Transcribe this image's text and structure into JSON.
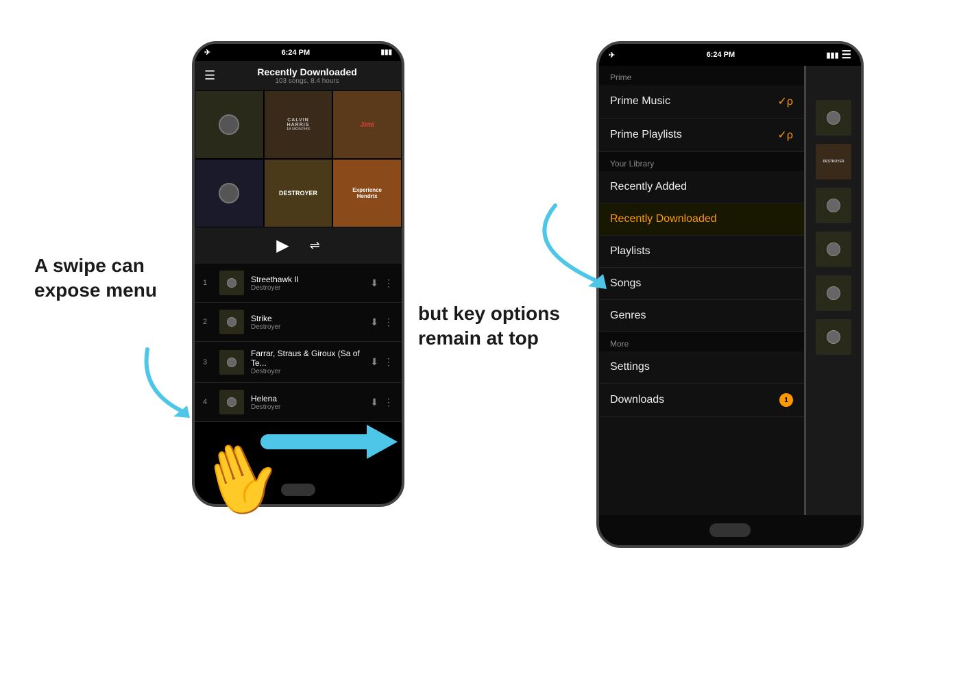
{
  "page": {
    "background": "#ffffff"
  },
  "annotation_left": {
    "line1": "A swipe can",
    "line2": "expose menu"
  },
  "annotation_right": {
    "line1": "but key options",
    "line2": "remain at top"
  },
  "phone_left": {
    "status_bar": {
      "signal": "✈",
      "time": "6:24 PM",
      "battery": "▮▮▮"
    },
    "header": {
      "title": "Recently Downloaded",
      "subtitle": "103 songs, 8.4 hours"
    },
    "songs": [
      {
        "num": "1",
        "title": "Streethawk II",
        "artist": "Destroyer"
      },
      {
        "num": "2",
        "title": "Strike",
        "artist": "Destroyer"
      },
      {
        "num": "3",
        "title": "Farrar, Straus & Giroux (S⁠a of Te...",
        "artist": "Destroyer"
      },
      {
        "num": "4",
        "title": "Helena",
        "artist": "Destroyer"
      }
    ]
  },
  "phone_right": {
    "status_bar": {
      "signal": "✈",
      "time": "6:24 PM",
      "battery": "▮▮▮"
    },
    "menu": {
      "section_prime": "Prime",
      "prime_music": "Prime Music",
      "prime_playlists": "Prime Playlists",
      "section_library": "Your Library",
      "recently_added": "Recently Added",
      "recently_downloaded": "Recently Downloaded",
      "playlists": "Playlists",
      "songs": "Songs",
      "genres": "Genres",
      "section_more": "More",
      "settings": "Settings",
      "downloads": "Downloads",
      "downloads_badge": "1"
    }
  }
}
